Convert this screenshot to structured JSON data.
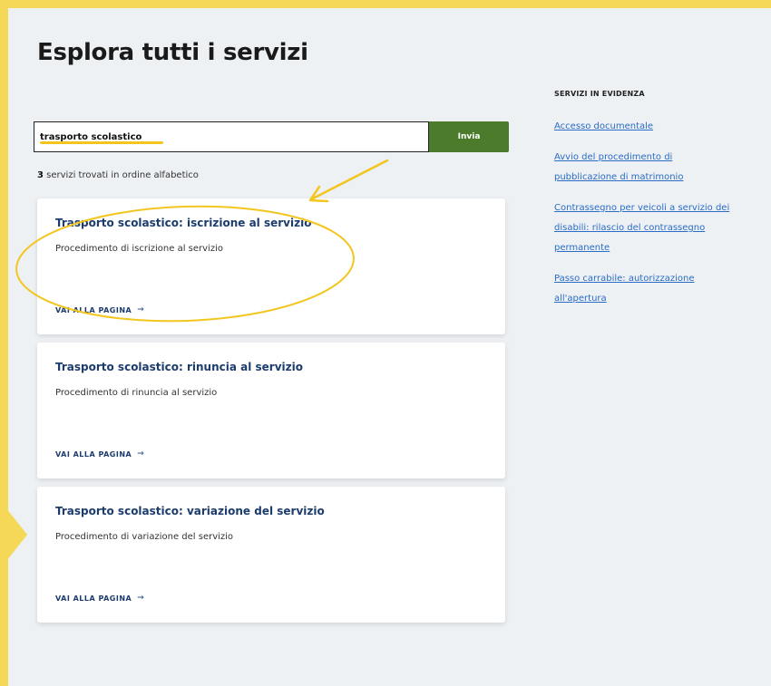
{
  "page": {
    "title": "Esplora tutti i servizi"
  },
  "search": {
    "value": "trasporto scolastico",
    "submit_label": "Invia"
  },
  "results": {
    "count": "3",
    "summary": "servizi trovati in ordine alfabetico",
    "items": [
      {
        "title": "Trasporto scolastico: iscrizione al servizio",
        "description": "Procedimento di iscrizione al servizio",
        "link_label": "VAI ALLA PAGINA"
      },
      {
        "title": "Trasporto scolastico: rinuncia al servizio",
        "description": "Procedimento di rinuncia al servizio",
        "link_label": "VAI ALLA PAGINA"
      },
      {
        "title": "Trasporto scolastico: variazione del servizio",
        "description": "Procedimento di variazione del servizio",
        "link_label": "VAI ALLA PAGINA"
      }
    ]
  },
  "aside": {
    "title": "SERVIZI IN EVIDENZA",
    "links": [
      "Accesso documentale",
      "Avvio del procedimento di pubblicazione di matrimonio",
      "Contrassegno per veicoli a servizio dei disabili: rilascio del contrassegno permanente",
      "Passo carrabile: autorizzazione all'apertura"
    ]
  },
  "icons": {
    "card_link": "arrow-right-icon"
  },
  "colors": {
    "annotation_yellow": "#f2c61f",
    "frame_yellow": "#f6d858",
    "submit_green": "#4b7b2b",
    "card_title_blue": "#1c3c6e",
    "link_blue": "#2a6cc6",
    "page_background": "#eef1f4"
  }
}
